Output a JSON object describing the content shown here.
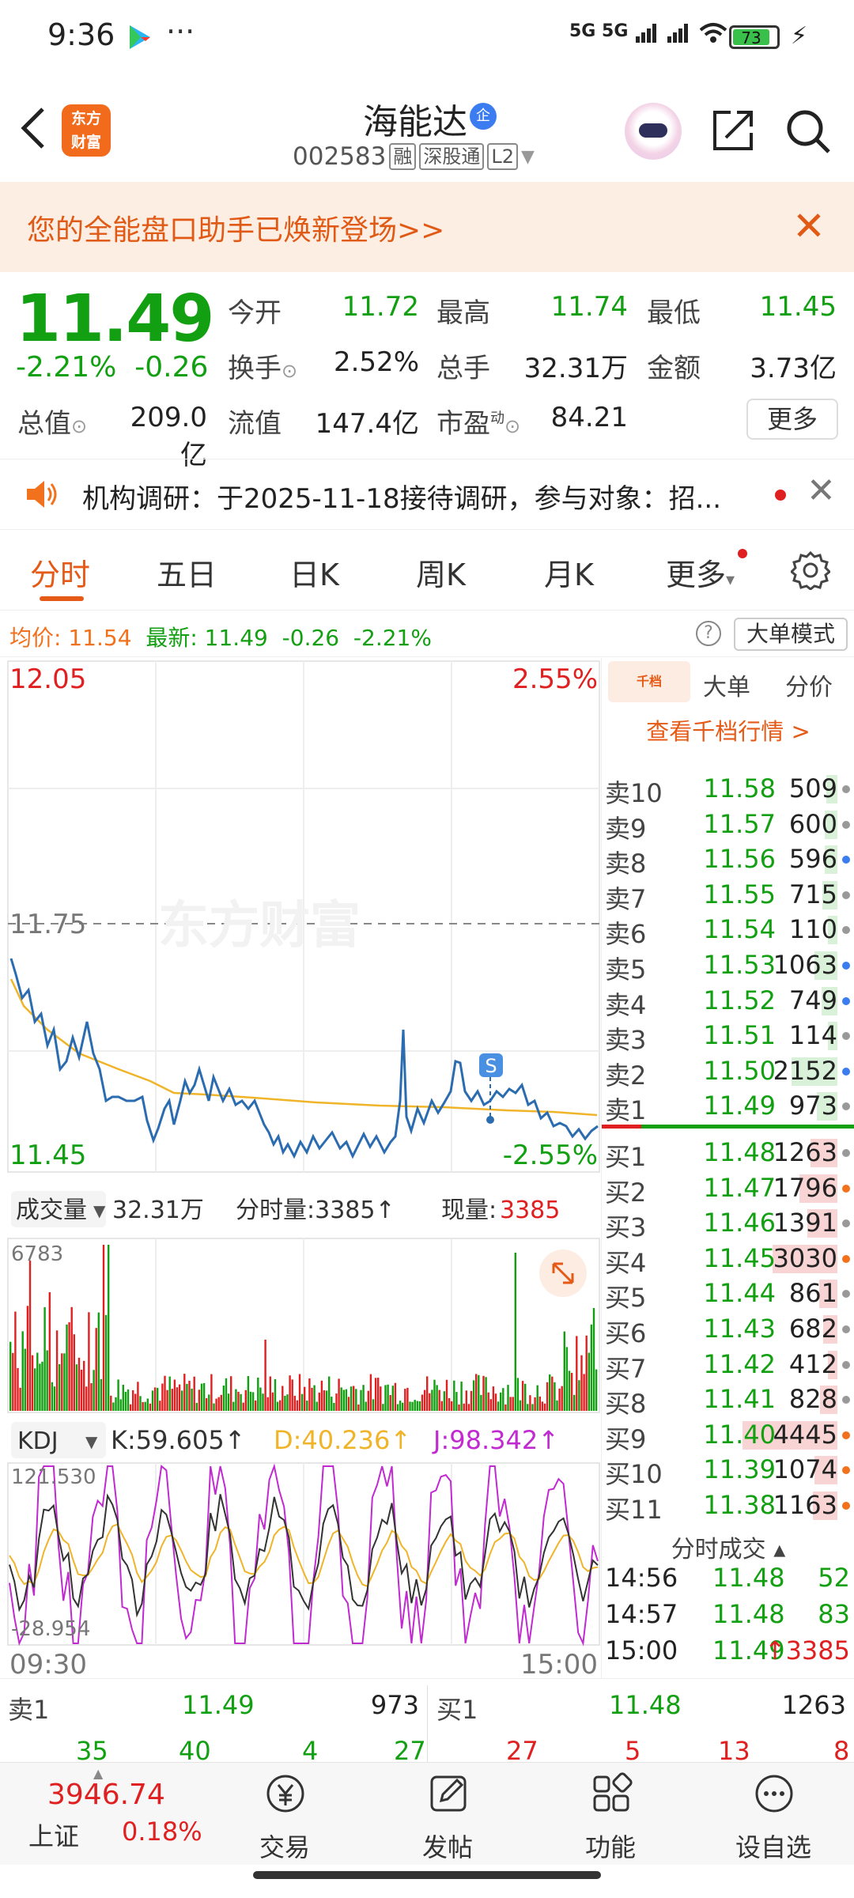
{
  "status_bar": {
    "time": "9:36",
    "dots": "···",
    "signal": "5G 5G",
    "battery": "73"
  },
  "header": {
    "logo_line1": "东方",
    "logo_line2": "财富",
    "stock_name": "海能达",
    "enterprise_badge": "企",
    "stock_code": "002583",
    "tags": [
      "融",
      "深股通",
      "L2"
    ]
  },
  "banner": {
    "text": "您的全能盘口助手已焕新登场>>",
    "close": "✕"
  },
  "quote": {
    "price": "11.49",
    "change_pct": "-2.21%",
    "change": "-0.26",
    "fields": [
      {
        "label": "今开",
        "value": "11.72",
        "color": "#12a012"
      },
      {
        "label": "最高",
        "value": "11.74",
        "color": "#12a012"
      },
      {
        "label": "最低",
        "value": "11.45",
        "color": "#12a012"
      },
      {
        "label": "换手",
        "value": "2.52%",
        "color": "#222222"
      },
      {
        "label": "总手",
        "value": "32.31万",
        "color": "#222222"
      },
      {
        "label": "金额",
        "value": "3.73亿",
        "color": "#222222"
      },
      {
        "label": "总值",
        "value": "209.0亿",
        "color": "#222222"
      },
      {
        "label": "流值",
        "value": "147.4亿",
        "color": "#222222"
      },
      {
        "label": "市盈",
        "value": "84.21",
        "color": "#222222"
      }
    ],
    "pe_superscript": "动",
    "more": "更多"
  },
  "notice": {
    "text": "机构调研：于2025-11-18接待调研，参与对象：招...",
    "close": "✕"
  },
  "tabs": [
    "分时",
    "五日",
    "日K",
    "周K",
    "月K",
    "更多"
  ],
  "avg_line": {
    "avg_label": "均价:",
    "avg_value": "11.54",
    "latest_label": "最新:",
    "latest_value": "11.49",
    "change": "-0.26",
    "change_pct": "-2.21%",
    "help": "?",
    "big_order_mode": "大单模式"
  },
  "chart": {
    "price_high": "12.05",
    "price_high_pct": "2.55%",
    "price_mid": "11.75",
    "price_low": "11.45",
    "price_low_pct": "-2.55%",
    "watermark": "东方财富",
    "s_marker": "S",
    "volume_label": "成交量",
    "volume_total": "32.31万",
    "minute_volume": "分时量:3385↑",
    "current_volume_label": "现量:",
    "current_volume": "3385",
    "volume_max": "6783",
    "kdj_label": "KDJ",
    "k_value": "K:59.605↑",
    "d_value": "D:40.236↑",
    "j_value": "J:98.342↑",
    "kdj_max": "121.530",
    "kdj_min": "-28.954",
    "time_start": "09:30",
    "time_end": "15:00"
  },
  "order_book": {
    "tabs": [
      "千档",
      "大单",
      "分价"
    ],
    "view_all": "查看千档行情 >",
    "sells": [
      {
        "label": "卖10",
        "price": "11.58",
        "vol": "509",
        "dot": "#999999"
      },
      {
        "label": "卖9",
        "price": "11.57",
        "vol": "600",
        "dot": "#999999"
      },
      {
        "label": "卖8",
        "price": "11.56",
        "vol": "596",
        "dot": "#3b7cf0"
      },
      {
        "label": "卖7",
        "price": "11.55",
        "vol": "715",
        "dot": "#999999"
      },
      {
        "label": "卖6",
        "price": "11.54",
        "vol": "110",
        "dot": "#999999"
      },
      {
        "label": "卖5",
        "price": "11.53",
        "vol": "1063",
        "dot": "#3b7cf0"
      },
      {
        "label": "卖4",
        "price": "11.52",
        "vol": "749",
        "dot": "#3b7cf0"
      },
      {
        "label": "卖3",
        "price": "11.51",
        "vol": "114",
        "dot": "#999999"
      },
      {
        "label": "卖2",
        "price": "11.50",
        "vol": "2152",
        "dot": "#3b7cf0"
      },
      {
        "label": "卖1",
        "price": "11.49",
        "vol": "973",
        "dot": "#999999"
      }
    ],
    "buys": [
      {
        "label": "买1",
        "price": "11.48",
        "vol": "1263",
        "dot": "#999999"
      },
      {
        "label": "买2",
        "price": "11.47",
        "vol": "1796",
        "dot": "#f2711c"
      },
      {
        "label": "买3",
        "price": "11.46",
        "vol": "1391",
        "dot": "#999999"
      },
      {
        "label": "买4",
        "price": "11.45",
        "vol": "3030",
        "dot": "#f2711c"
      },
      {
        "label": "买5",
        "price": "11.44",
        "vol": "861",
        "dot": "#999999"
      },
      {
        "label": "买6",
        "price": "11.43",
        "vol": "682",
        "dot": "#999999"
      },
      {
        "label": "买7",
        "price": "11.42",
        "vol": "412",
        "dot": "#999999"
      },
      {
        "label": "买8",
        "price": "11.41",
        "vol": "828",
        "dot": "#999999"
      },
      {
        "label": "买9",
        "price": "11.40",
        "vol": "4445",
        "dot": "#f2711c"
      },
      {
        "label": "买10",
        "price": "11.39",
        "vol": "1074",
        "dot": "#f2711c"
      },
      {
        "label": "买11",
        "price": "11.38",
        "vol": "1163",
        "dot": "#f2711c"
      }
    ],
    "trades_header": "分时成交 ▴",
    "trades": [
      {
        "time": "14:56",
        "price": "11.48",
        "vol": "52",
        "color": "#12a012"
      },
      {
        "time": "14:57",
        "price": "11.48",
        "vol": "83",
        "color": "#12a012"
      },
      {
        "time": "15:00",
        "price": "11.49",
        "vol": "↑3385",
        "color": "#e02020"
      }
    ]
  },
  "bottom_quote": {
    "sell1_label": "卖1",
    "sell1_price": "11.49",
    "sell1_vol": "973",
    "buy1_label": "买1",
    "buy1_price": "11.48",
    "buy1_vol": "1263",
    "left_nums": [
      "35",
      "40",
      "4",
      "27"
    ],
    "right_nums": [
      "27",
      "5",
      "13",
      "8"
    ]
  },
  "index": {
    "value": "3946.74",
    "name": "上证",
    "pct": "0.18%"
  },
  "nav": [
    "交易",
    "发帖",
    "功能",
    "设自选"
  ]
}
